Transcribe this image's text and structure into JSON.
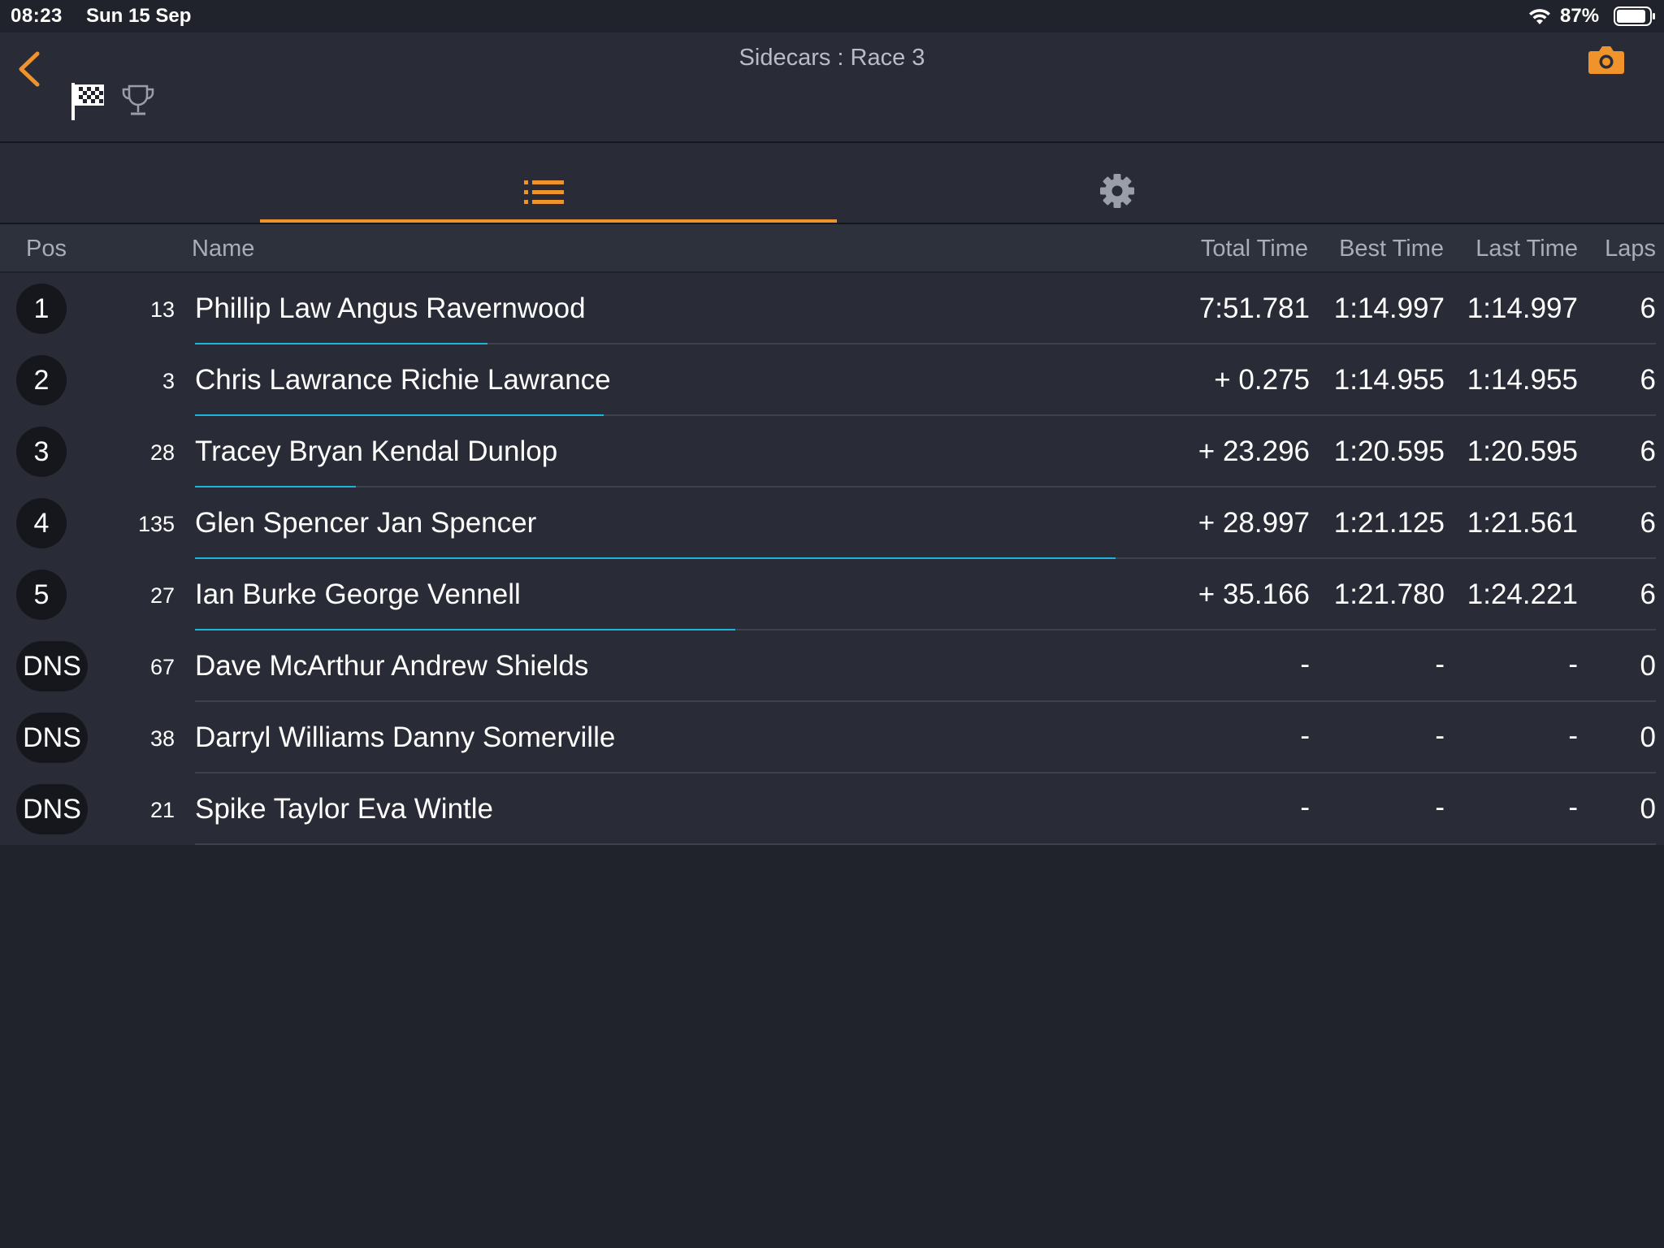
{
  "status_bar": {
    "time": "08:23",
    "date": "Sun 15 Sep",
    "battery_pct": "87%"
  },
  "header": {
    "title": "Sidecars : Race 3"
  },
  "colors": {
    "accent": "#f0932b",
    "progress": "#1fb5d9",
    "background": "#20232b",
    "row_bg": "#292c36"
  },
  "icons": {
    "back": "chevron-left-icon",
    "flag": "checkered-flag-icon",
    "trophy": "trophy-icon",
    "camera": "camera-icon",
    "list_tab": "list-icon",
    "settings_tab": "gear-icon"
  },
  "table": {
    "headers": {
      "pos": "Pos",
      "name": "Name",
      "total": "Total Time",
      "best": "Best Time",
      "last": "Last Time",
      "laps": "Laps"
    },
    "rows": [
      {
        "pos": "1",
        "num": "13",
        "name": "Phillip Law Angus Ravernwood",
        "total": "7:51.781",
        "best": "1:14.997",
        "last": "1:14.997",
        "laps": "6",
        "progress": 0.2
      },
      {
        "pos": "2",
        "num": "3",
        "name": "Chris Lawrance Richie Lawrance",
        "total": "+ 0.275",
        "best": "1:14.955",
        "last": "1:14.955",
        "laps": "6",
        "progress": 0.28
      },
      {
        "pos": "3",
        "num": "28",
        "name": "Tracey Bryan Kendal Dunlop",
        "total": "+ 23.296",
        "best": "1:20.595",
        "last": "1:20.595",
        "laps": "6",
        "progress": 0.11
      },
      {
        "pos": "4",
        "num": "135",
        "name": "Glen Spencer Jan Spencer",
        "total": "+ 28.997",
        "best": "1:21.125",
        "last": "1:21.561",
        "laps": "6",
        "progress": 0.63
      },
      {
        "pos": "5",
        "num": "27",
        "name": "Ian Burke George Vennell",
        "total": "+ 35.166",
        "best": "1:21.780",
        "last": "1:24.221",
        "laps": "6",
        "progress": 0.37
      },
      {
        "pos": "DNS",
        "num": "67",
        "name": "Dave McArthur Andrew Shields",
        "total": "-",
        "best": "-",
        "last": "-",
        "laps": "0",
        "progress": 0
      },
      {
        "pos": "DNS",
        "num": "38",
        "name": "Darryl Williams Danny Somerville",
        "total": "-",
        "best": "-",
        "last": "-",
        "laps": "0",
        "progress": 0
      },
      {
        "pos": "DNS",
        "num": "21",
        "name": "Spike Taylor Eva Wintle",
        "total": "-",
        "best": "-",
        "last": "-",
        "laps": "0",
        "progress": 0
      }
    ]
  }
}
